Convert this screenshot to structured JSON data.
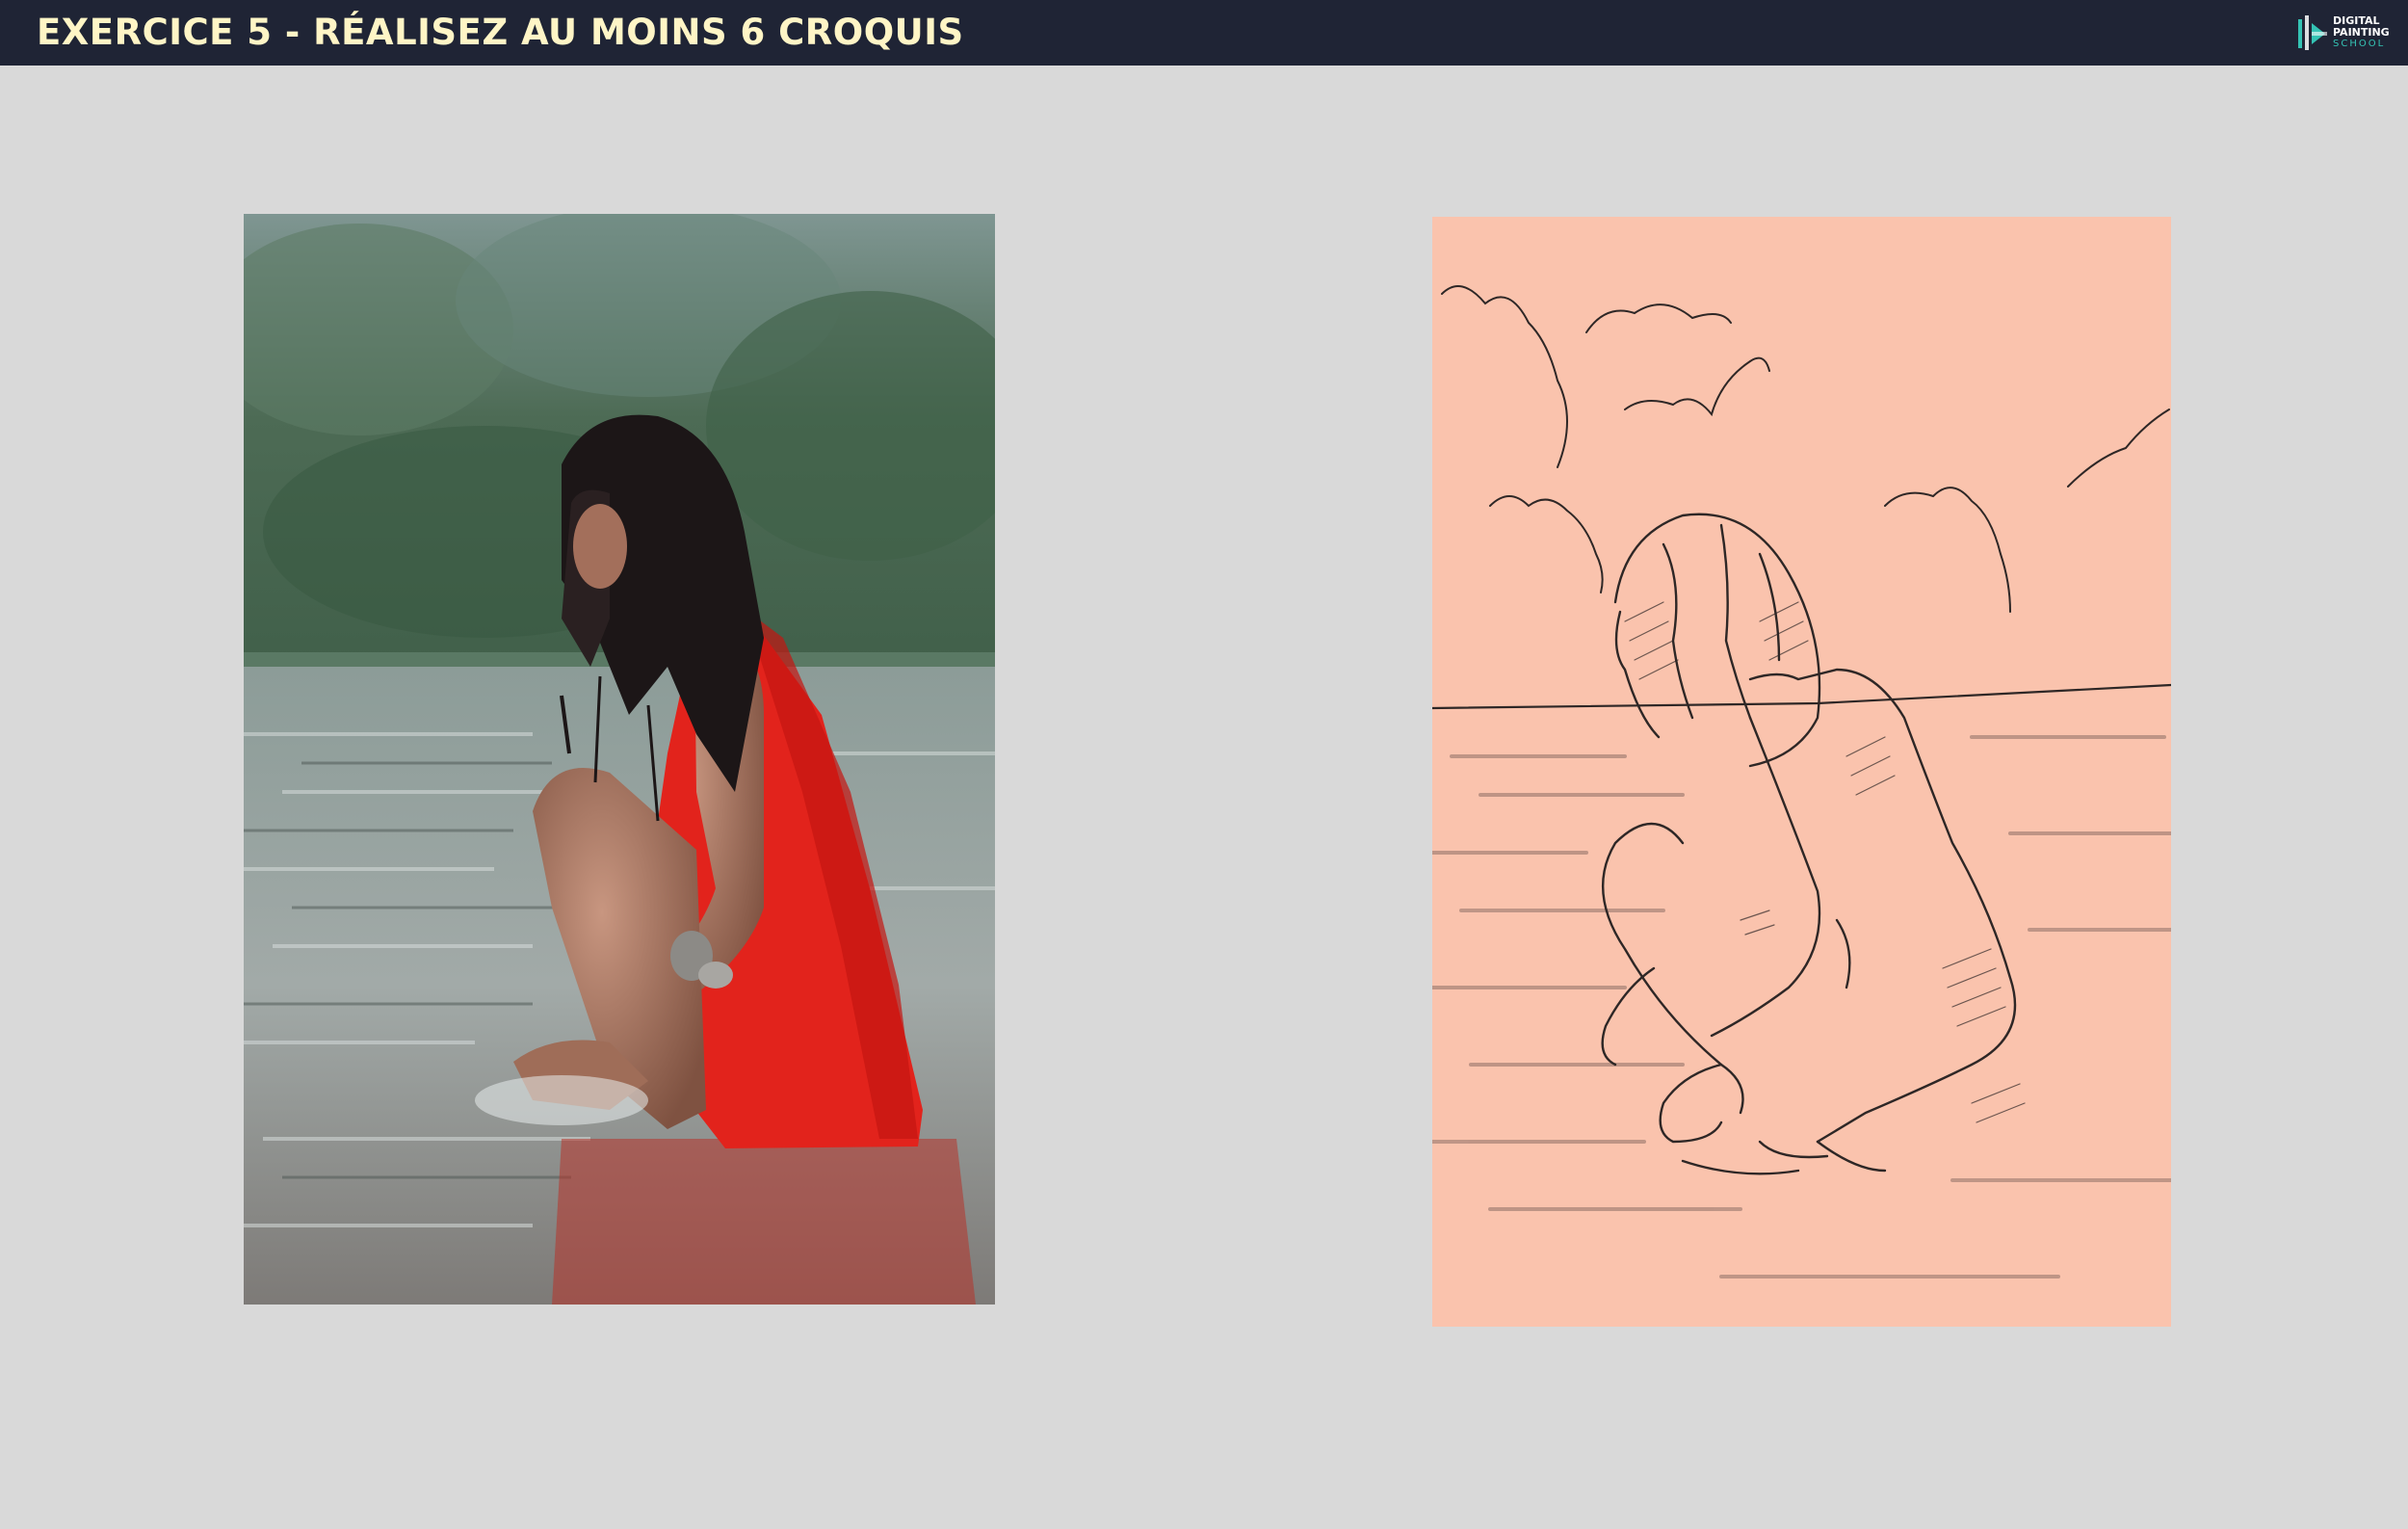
{
  "header": {
    "title": "EXERCICE 5 - RÉALISEZ AU MOINS 6 CROQUIS",
    "logo": {
      "line1": "DIGITAL",
      "line2": "PAINTING",
      "line3": "SCHOOL",
      "icon": "digital-painting-school-logo-icon"
    }
  },
  "colors": {
    "header_bg": "#1f2435",
    "title": "#fff5c6",
    "page_bg": "#d9d9d9",
    "sketch_bg": "#fac3ad",
    "logo_accent": "#34c3b4"
  },
  "reference_photo": {
    "subject": "reference-photo-girl-red-dress-crouching-in-water"
  },
  "sketch": {
    "subject": "line-sketch-girl-crouching-in-water"
  }
}
